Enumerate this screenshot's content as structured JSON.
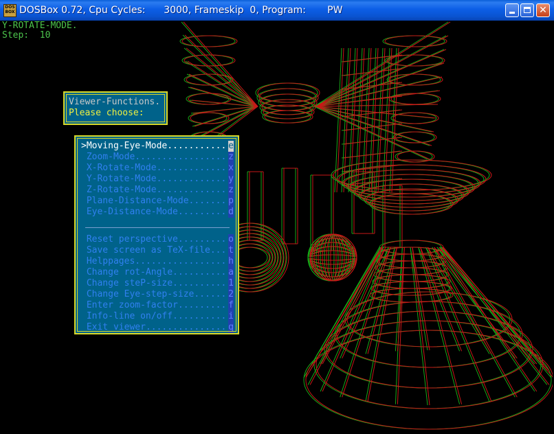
{
  "titlebar": {
    "title": "DOSBox 0.72, Cpu Cycles:      3000, Frameskip  0, Program:       PW",
    "icon_label": "DOS BOX",
    "icons": {
      "app": "dosbox-icon",
      "minimize": "minimize-icon",
      "maximize": "maximize-icon",
      "close": "close-icon"
    },
    "close_glyph": "✕"
  },
  "status": {
    "mode_text": "Y-ROTATE-MODE.",
    "step_text": "Step:  10"
  },
  "viewer_box": {
    "title": "Viewer-Functions.",
    "prompt": "Please choose:"
  },
  "menu": {
    "items": [
      {
        "label": ">Moving-Eye-Mode...........",
        "key": "e",
        "selected": true
      },
      {
        "label": " Zoom-Mode..................",
        "key": "z"
      },
      {
        "label": " X-Rotate-Mode..............",
        "key": "x"
      },
      {
        "label": " Y-Rotate-Mode..............",
        "key": "y"
      },
      {
        "label": " Z-Rotate-Mode..............",
        "key": "z"
      },
      {
        "label": " Plane-Distance-Mode........",
        "key": "p"
      },
      {
        "label": " Eye-Distance-Mode..........",
        "key": "d"
      },
      {
        "label": " Reset perspective..........",
        "key": "o"
      },
      {
        "label": " Save screen as TeX-file....",
        "key": "t"
      },
      {
        "label": " Helppages..................",
        "key": "h"
      },
      {
        "label": " Change rot-Angle...........",
        "key": "a"
      },
      {
        "label": " Change steP-size...........",
        "key": "1"
      },
      {
        "label": " Change Eye-step-size.......",
        "key": "2"
      },
      {
        "label": " Enter zoom-factor..........",
        "key": "f"
      },
      {
        "label": " Info-line on/off...........",
        "key": "i"
      },
      {
        "label": " Exit viewer................",
        "key": "q"
      }
    ]
  },
  "colors": {
    "wire_red": "#c81818",
    "wire_green": "#18a818",
    "dialog_bg": "#00628a",
    "dialog_border": "#d8d828",
    "status_text": "#4cc44c"
  }
}
